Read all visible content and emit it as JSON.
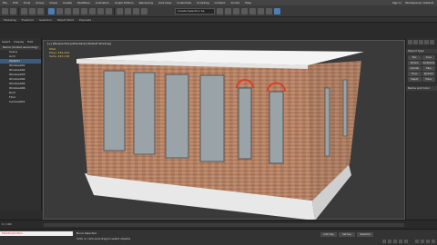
{
  "menubar": {
    "items": [
      "File",
      "Edit",
      "Tools",
      "Group",
      "Views",
      "Create",
      "Modifiers",
      "Animation",
      "Graph Editors",
      "Rendering",
      "Civil View",
      "Customize",
      "Scripting",
      "Content",
      "Arnold",
      "Help"
    ],
    "signin": "Sign In",
    "workspace": "Workspaces: Default"
  },
  "toolbar": {
    "selection_set": "Create Selection Se"
  },
  "ribbon": {
    "tabs": [
      "Modeling",
      "Freeform",
      "Selection",
      "Object Paint",
      "Populate"
    ]
  },
  "explorer": {
    "tabs": [
      "Select",
      "Display",
      "Edit"
    ],
    "header": "Name (Sorted Ascending)",
    "rows": [
      "Scene",
      "Arch",
      "Wall001",
      "Window001",
      "Window002",
      "Window003",
      "Window004",
      "Window005",
      "Window006",
      "Roof",
      "Floor",
      "Camera001"
    ]
  },
  "viewport": {
    "label": "[+] [Perspective] [Standard] [Default Shading]",
    "stats": [
      "Total",
      "Polys: 481,424",
      "Verts: 243,118"
    ]
  },
  "cmdpanel": {
    "section1": "Object Type",
    "buttons": [
      "Box",
      "Cone",
      "Sphere",
      "GeoSphere",
      "Cylinder",
      "Tube",
      "Torus",
      "Pyramid",
      "Teapot",
      "Plane"
    ],
    "section2": "Name and Color"
  },
  "timeline": {
    "frame": "0 / 100"
  },
  "statusbar": {
    "script": "MAXScript Mini",
    "msg1": "None Selected",
    "msg2": "Click or click-and-drag to select objects",
    "autokey": "Auto Key",
    "setkey": "Set Key",
    "selected": "Selected"
  },
  "colors": {
    "accent": "#4a7fb5",
    "wall": "#b07a5c",
    "roof": "#f4f4f4",
    "arch": "#d8402a"
  }
}
